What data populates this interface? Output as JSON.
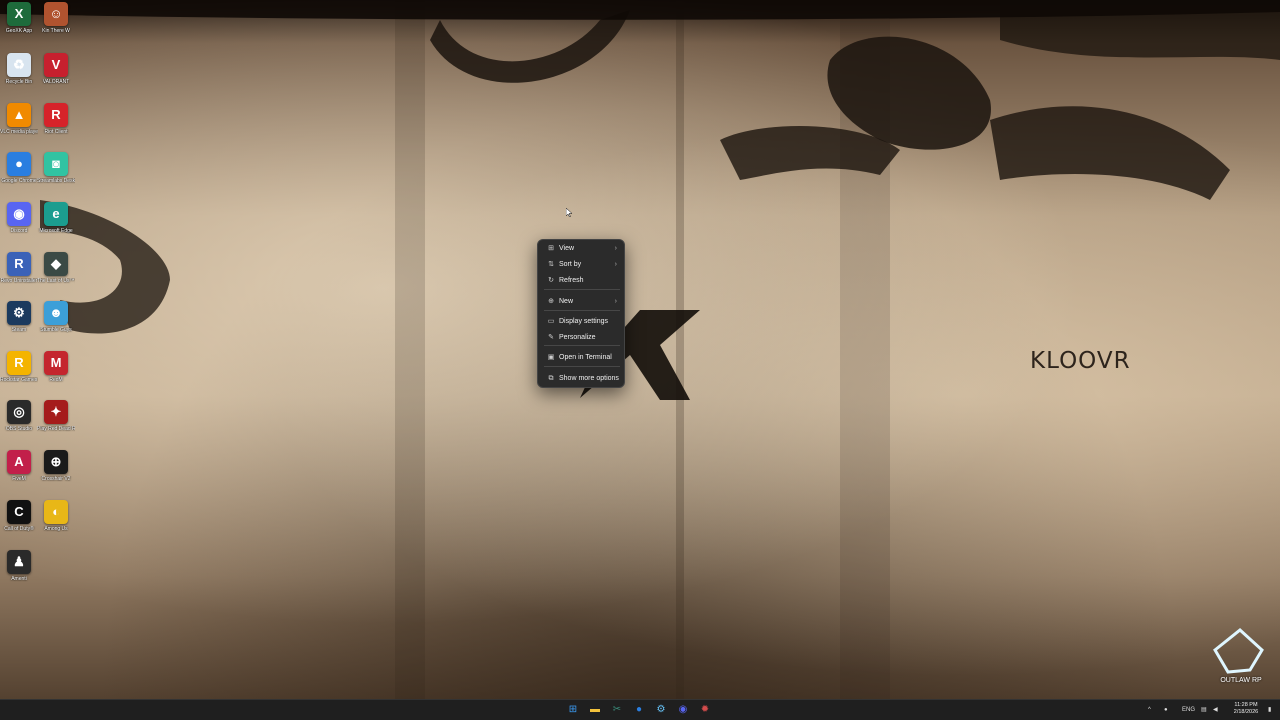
{
  "desktop": {
    "brand_text": "KLOOVR",
    "watermark_label": "OUTLAW RP",
    "icons": [
      {
        "label": "GeoXK App",
        "icon": "geoxk-icon",
        "color": "#1e6b3b",
        "glyph": "X"
      },
      {
        "label": "Kin There W",
        "icon": "character-avatar-icon",
        "color": "#b0532f",
        "glyph": "☺"
      },
      {
        "label": "Recycle Bin",
        "icon": "recycle-bin-icon",
        "color": "#d8e4ef",
        "glyph": "♻"
      },
      {
        "label": "VALORANT",
        "icon": "valorant-icon",
        "color": "#c7202e",
        "glyph": "V"
      },
      {
        "label": "VLC media player",
        "icon": "vlc-icon",
        "color": "#f08a00",
        "glyph": "▲"
      },
      {
        "label": "Riot Client",
        "icon": "riot-client-icon",
        "color": "#d6232a",
        "glyph": "R"
      },
      {
        "label": "Google Chrome",
        "icon": "chrome-icon",
        "color": "#2a7ee0",
        "glyph": "●"
      },
      {
        "label": "Streamlabs Desktop",
        "icon": "streamlabs-icon",
        "color": "#31c3a2",
        "glyph": "◙"
      },
      {
        "label": "Discord",
        "icon": "discord-icon",
        "color": "#5865f2",
        "glyph": "◉"
      },
      {
        "label": "Microsoft Edge",
        "icon": "edge-icon",
        "color": "#1b9d8f",
        "glyph": "e"
      },
      {
        "label": "Revo Uninstaller",
        "icon": "revo-uninstaller-icon",
        "color": "#3a62b8",
        "glyph": "R"
      },
      {
        "label": "The Last of Us™ Part I",
        "icon": "game-cover-icon",
        "color": "#3b4a45",
        "glyph": "◆"
      },
      {
        "label": "Steam",
        "icon": "steam-icon",
        "color": "#1b3a5e",
        "glyph": "⚙"
      },
      {
        "label": "Stumble Guys",
        "icon": "stumble-guys-icon",
        "color": "#3c9fd8",
        "glyph": "☻"
      },
      {
        "label": "Rockstar Games Launcher",
        "icon": "rockstar-icon",
        "color": "#f4b400",
        "glyph": "R"
      },
      {
        "label": "RedM",
        "icon": "redm-icon",
        "color": "#c4262e",
        "glyph": "M"
      },
      {
        "label": "OBS Studio",
        "icon": "obs-icon",
        "color": "#2a2a2a",
        "glyph": "◎"
      },
      {
        "label": "Play Red Dead Rede...",
        "icon": "red-dead-icon",
        "color": "#a51b1b",
        "glyph": "✦"
      },
      {
        "label": "FiveM",
        "icon": "fivem-icon",
        "color": "#c21f4a",
        "glyph": "A"
      },
      {
        "label": "Crosshair V2",
        "icon": "crosshair-icon",
        "color": "#1a1a1a",
        "glyph": "⊕"
      },
      {
        "label": "Call of Duty®",
        "icon": "call-of-duty-icon",
        "color": "#111111",
        "glyph": "C"
      },
      {
        "label": "Among Us",
        "icon": "among-us-icon",
        "color": "#e8b717",
        "glyph": "◐"
      },
      {
        "label": "Amenti",
        "icon": "amenti-icon",
        "color": "#2a2a2a",
        "glyph": "♟"
      }
    ]
  },
  "context_menu": {
    "items": [
      {
        "label": "View",
        "icon": "view-grid-icon",
        "glyph": "⊞",
        "submenu": true
      },
      {
        "label": "Sort by",
        "icon": "sort-icon",
        "glyph": "⇅",
        "submenu": true
      },
      {
        "label": "Refresh",
        "icon": "refresh-icon",
        "glyph": "↻",
        "submenu": false
      },
      {
        "label": "New",
        "icon": "new-plus-icon",
        "glyph": "⊕",
        "submenu": true
      },
      {
        "label": "Display settings",
        "icon": "display-icon",
        "glyph": "▭",
        "submenu": false
      },
      {
        "label": "Personalize",
        "icon": "personalize-pen-icon",
        "glyph": "✎",
        "submenu": false
      },
      {
        "label": "Open in Terminal",
        "icon": "terminal-icon",
        "glyph": "▣",
        "submenu": false
      },
      {
        "label": "Show more options",
        "icon": "more-options-icon",
        "glyph": "⧉",
        "submenu": false
      }
    ]
  },
  "taskbar": {
    "apps": [
      {
        "icon": "windows-start-icon",
        "glyph": "⊞",
        "color": "#3b9cf5"
      },
      {
        "icon": "file-explorer-icon",
        "glyph": "▬",
        "color": "#f3c23c"
      },
      {
        "icon": "snipping-tool-icon",
        "glyph": "✂",
        "color": "#3a8b7a"
      },
      {
        "icon": "chrome-taskbar-icon",
        "glyph": "●",
        "color": "#2a7ee0"
      },
      {
        "icon": "steam-taskbar-icon",
        "glyph": "⚙",
        "color": "#66c0f4"
      },
      {
        "icon": "discord-taskbar-icon",
        "glyph": "◉",
        "color": "#5865f2"
      },
      {
        "icon": "settings-taskbar-icon",
        "glyph": "✹",
        "color": "#d44c4c"
      }
    ],
    "tray": {
      "chevron": "^",
      "language": "ENG",
      "time": "11:28 PM",
      "date": "2/18/2026"
    }
  }
}
